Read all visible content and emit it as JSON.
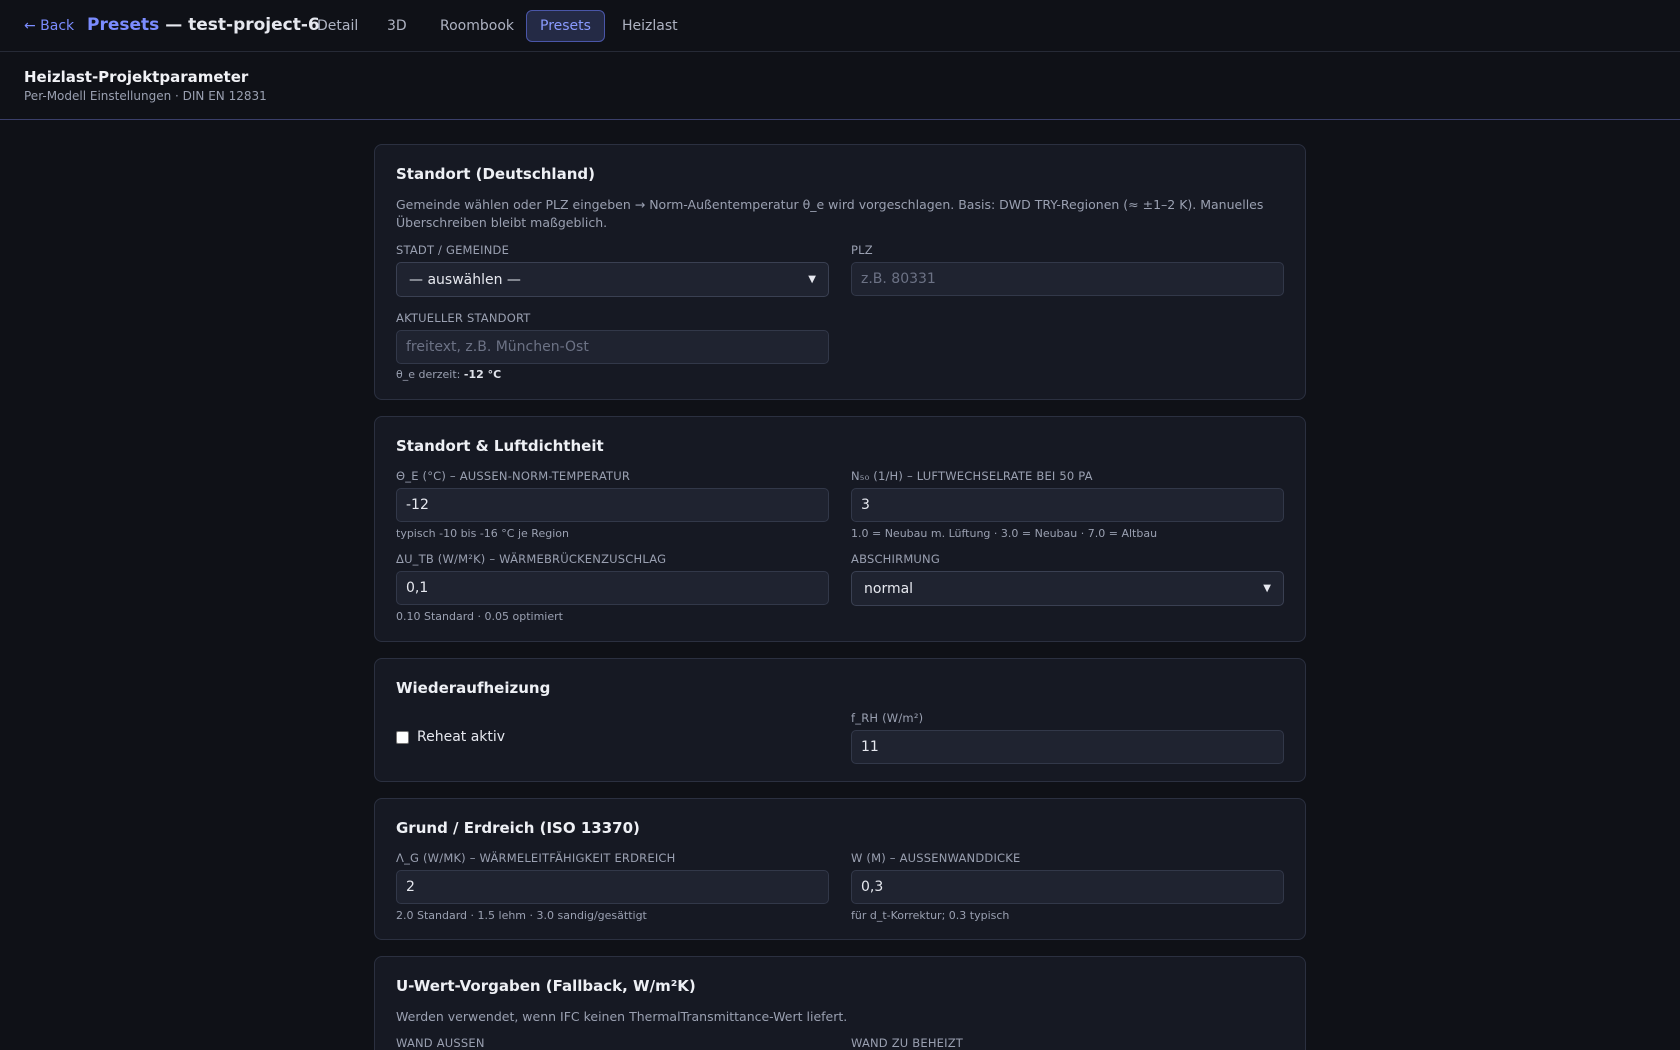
{
  "nav": {
    "back_label": "← Back",
    "title_accent": "Presets",
    "title_rest": " — test-project-6",
    "tabs": [
      {
        "label": "Detail"
      },
      {
        "label": "3D"
      },
      {
        "label": "Roombook"
      },
      {
        "label": "Presets"
      },
      {
        "label": "Heizlast"
      }
    ],
    "active_tab": "Presets"
  },
  "page": {
    "title": "Heizlast-Projektparameter",
    "subtitle": "Per-Modell Einstellungen · DIN EN 12831"
  },
  "standort": {
    "title": "Standort (Deutschland)",
    "desc": "Gemeinde wählen oder PLZ eingeben → Norm-Außentemperatur θ_e wird vorgeschlagen. Basis: DWD TRY-Regionen (≈ ±1–2 K). Manuelles Überschreiben bleibt maßgeblich.",
    "city_label": "Stadt / Gemeinde",
    "city_value": "— auswählen —",
    "plz_label": "PLZ",
    "plz_placeholder": "z.B. 80331",
    "current_label": "Aktueller Standort",
    "current_placeholder": "freitext, z.B. München-Ost",
    "theta_prefix": "θ_e derzeit: ",
    "theta_value": "-12 °C"
  },
  "luft": {
    "title": "Standort & Luftdichtheit",
    "theta_label": "θ_e (°C) – Aussen-Norm-Temperatur",
    "theta_value": "-12",
    "theta_hint": "typisch -10 bis -16 °C je Region",
    "n50_label": "n₅₀ (1/h) – Luftwechselrate bei 50 Pa",
    "n50_value": "3",
    "n50_hint": "1.0 = Neubau m. Lüftung · 3.0 = Neubau · 7.0 = Altbau",
    "du_label": "ΔU_TB (W/m²K) – Wärmebrückenzuschlag",
    "du_value": "0,1",
    "du_hint": "0.10 Standard · 0.05 optimiert",
    "abschirm_label": "Abschirmung",
    "abschirm_value": "normal"
  },
  "reheat": {
    "title": "Wiederaufheizung",
    "checkbox_label": "Reheat aktiv",
    "checked": false,
    "frh_label": "f_RH (W/m²)",
    "frh_value": "11"
  },
  "grund": {
    "title": "Grund / Erdreich (ISO 13370)",
    "lambda_label": "λ_g (W/mK) – Wärmeleitfähigkeit Erdreich",
    "lambda_value": "2",
    "lambda_hint": "2.0 Standard · 1.5 lehm · 3.0 sandig/gesättigt",
    "w_label": "w (m) – Aussenwanddicke",
    "w_value": "0,3",
    "w_hint": "für d_t-Korrektur; 0.3 typisch"
  },
  "uwert": {
    "title": "U-Wert-Vorgaben (Fallback, W/m²K)",
    "desc": "Werden verwendet, wenn IFC keinen ThermalTransmittance-Wert liefert.",
    "wand_aussen_label": "Wand aussen",
    "wand_beheizt_label": "Wand zu beheizt"
  }
}
